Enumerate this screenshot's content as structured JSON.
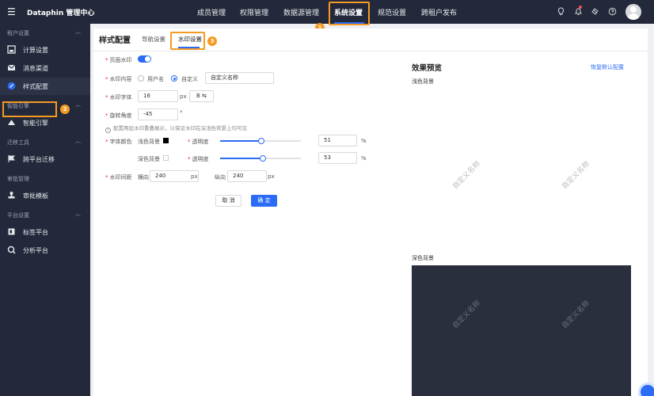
{
  "topbar": {
    "menu_icon": "☰",
    "brand": "Dataphin 管理中心",
    "nav": [
      "成员管理",
      "权限管理",
      "数据源管理",
      "系统设置",
      "规范设置",
      "跨租户发布"
    ],
    "icons": [
      "bulb-icon",
      "bell-icon",
      "service-icon",
      "help-icon"
    ]
  },
  "callouts": [
    "1",
    "2",
    "3"
  ],
  "sidebar": {
    "groups": [
      {
        "title": "租户设置",
        "items": [
          {
            "label": "计算设置",
            "icon": "compute-icon"
          },
          {
            "label": "消息渠道",
            "icon": "mail-icon"
          },
          {
            "label": "样式配置",
            "icon": "palette-icon"
          }
        ]
      },
      {
        "title": "智能引擎",
        "items": [
          {
            "label": "智能引擎",
            "icon": "engine-icon"
          }
        ]
      },
      {
        "title": "迁移工具",
        "items": [
          {
            "label": "跨平台迁移",
            "icon": "migrate-icon"
          }
        ]
      },
      {
        "title": "审批管理",
        "items": [
          {
            "label": "审批模板",
            "icon": "stamp-icon"
          }
        ]
      },
      {
        "title": "平台设置",
        "items": [
          {
            "label": "标签平台",
            "icon": "tag-icon"
          },
          {
            "label": "分析平台",
            "icon": "analysis-icon"
          }
        ]
      }
    ]
  },
  "page": {
    "title": "样式配置",
    "tabs": [
      "导航设置",
      "水印设置"
    ]
  },
  "form": {
    "req_mark": "*",
    "page_watermark_label": "页面水印",
    "content_label": "水印内容",
    "content_opt_user": "用户名",
    "content_opt_custom": "自定义",
    "content_value": "自定义名称",
    "font_label": "水印字体",
    "font_size": "16",
    "font_unit": "px",
    "font_style_btn": "B ⇆",
    "rotate_label": "旋转角度",
    "rotate_value": "-45",
    "rotate_unit": "°",
    "hint": "配置两层水印重叠展示，以保证水印在深浅色背景上均可见",
    "color_label": "字体颜色",
    "light_bg_label": "浅色背景",
    "dark_bg_label": "深色背景",
    "opacity_label": "透明度",
    "light_opacity": "51",
    "dark_opacity": "53",
    "percent": "%",
    "spacing_label": "水印间距",
    "horizontal_label": "横向",
    "horizontal_value": "240",
    "vertical_label": "纵向",
    "vertical_value": "240",
    "cancel": "取 消",
    "confirm": "确 定",
    "colors": {
      "light_swatch": "#000000",
      "dark_swatch": "#ffffff"
    },
    "light_opacity_fraction": 0.51,
    "dark_opacity_fraction": 0.53
  },
  "preview": {
    "title": "效果预览",
    "restore": "恢复默认配置",
    "light_label": "浅色背景",
    "dark_label": "深色背景",
    "watermark_text": "自定义名称"
  },
  "colors": {
    "accent": "#2a6cf6",
    "callout": "#f59a23",
    "nav_bg": "#23293a",
    "dark_preview": "#2a2f3e"
  }
}
